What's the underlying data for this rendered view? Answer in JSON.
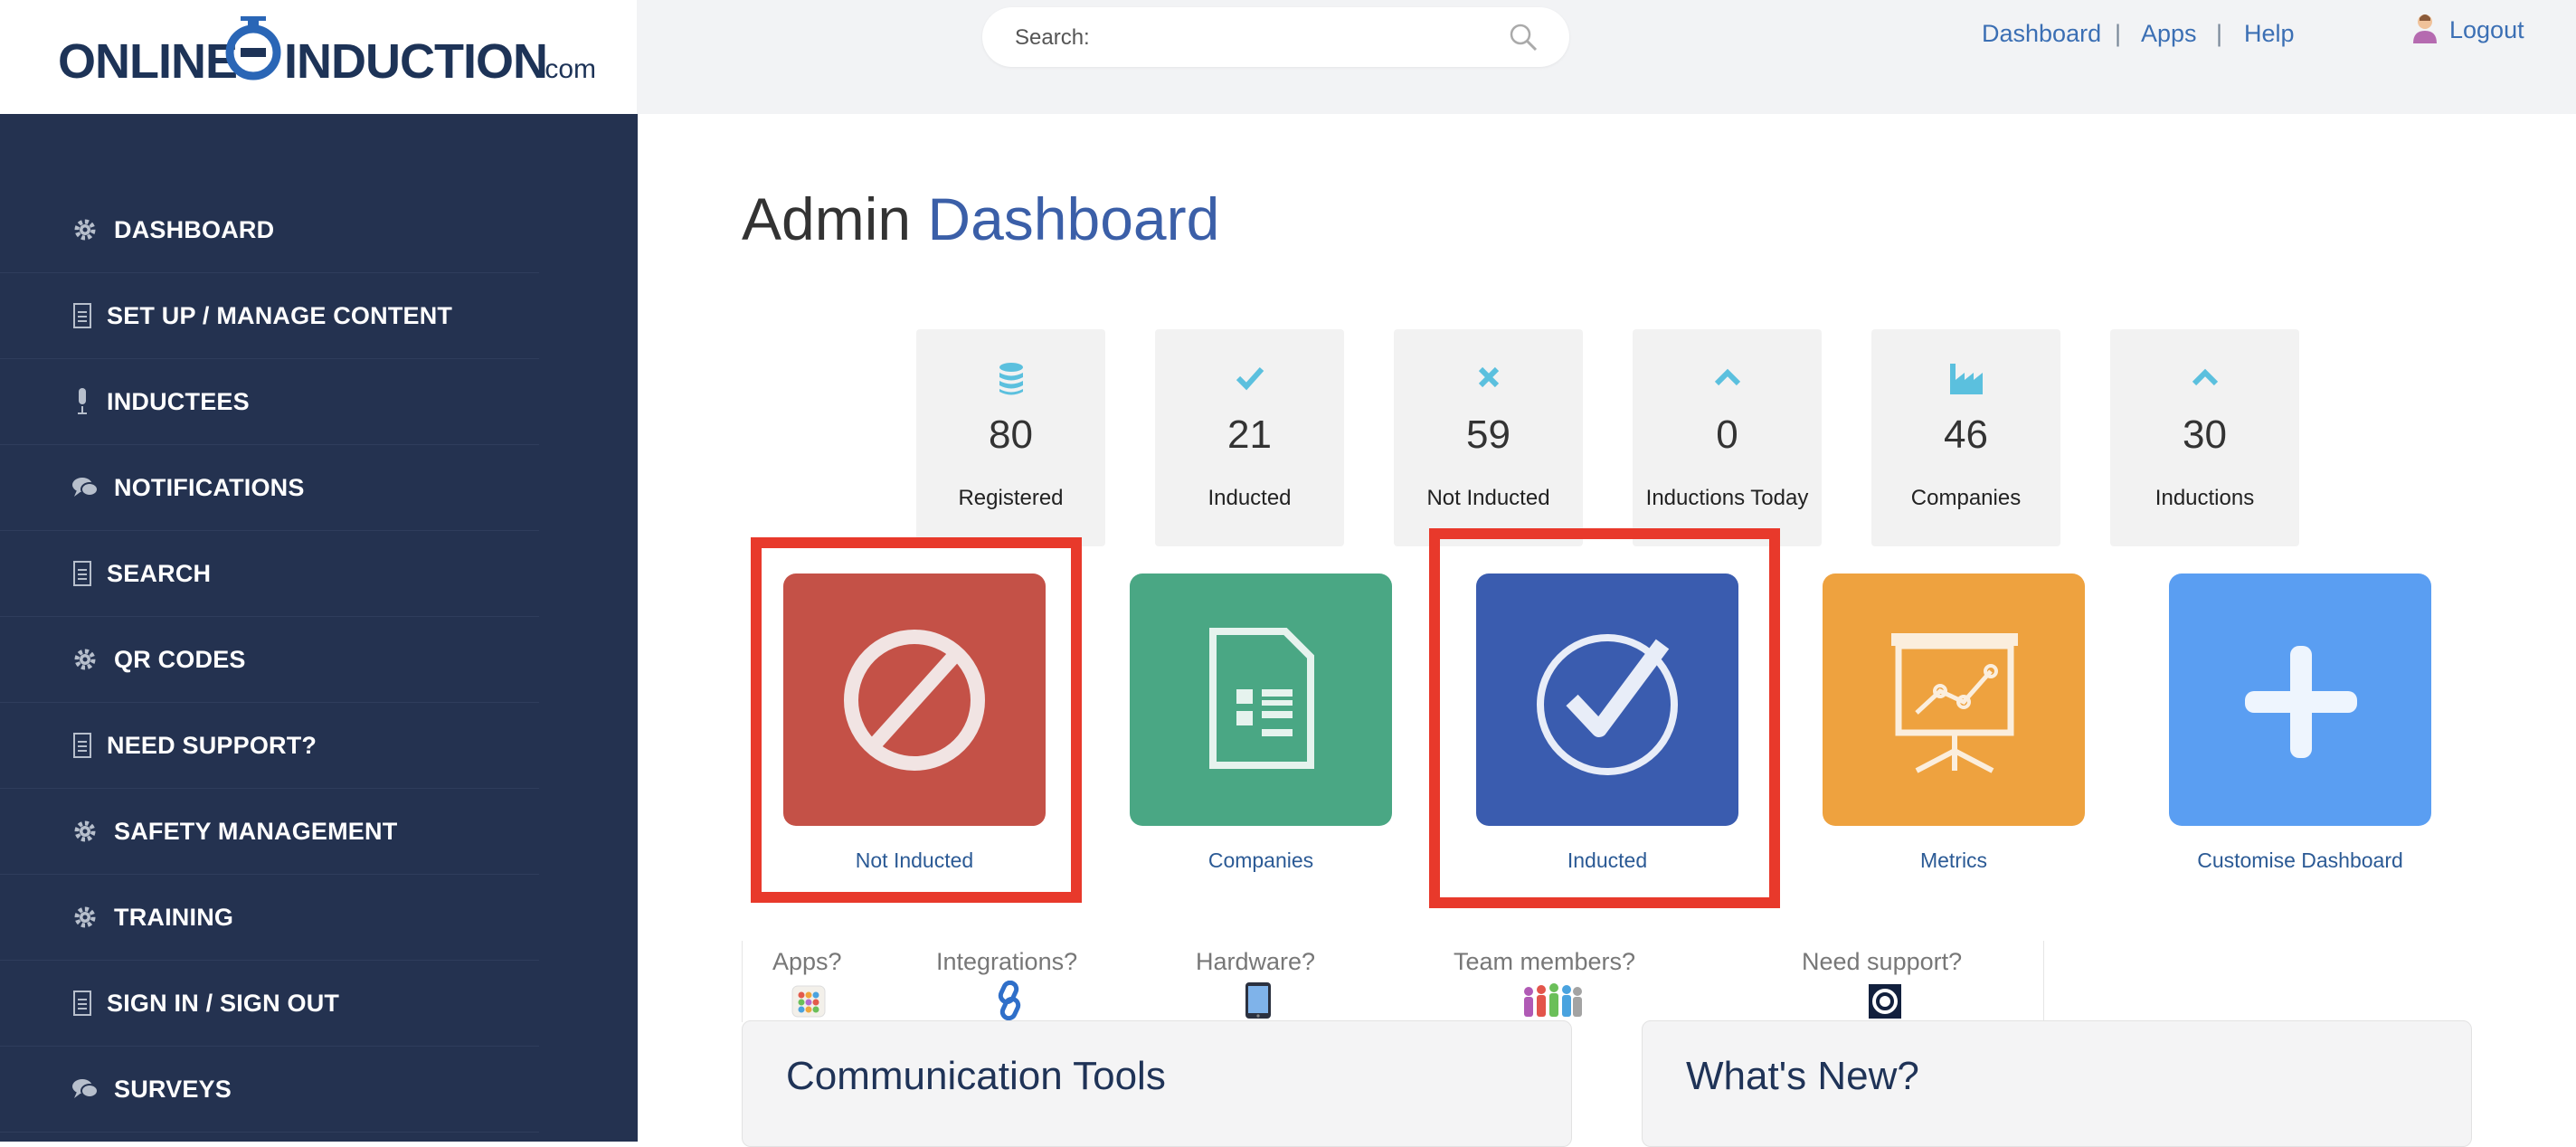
{
  "logo": {
    "text_left": "ONLINE",
    "text_right": "INDUCTION",
    "suffix": ".com"
  },
  "search": {
    "label": "Search:"
  },
  "top_nav": {
    "dashboard": "Dashboard",
    "apps": "Apps",
    "help": "Help",
    "separator": "|",
    "logout": "Logout"
  },
  "sidebar": {
    "items": [
      {
        "label": "DASHBOARD",
        "icon": "gear-icon"
      },
      {
        "label": "SET UP / MANAGE CONTENT",
        "icon": "document-icon"
      },
      {
        "label": "INDUCTEES",
        "icon": "microphone-icon"
      },
      {
        "label": "NOTIFICATIONS",
        "icon": "chat-icon"
      },
      {
        "label": "SEARCH",
        "icon": "document-icon"
      },
      {
        "label": "QR CODES",
        "icon": "gear-icon"
      },
      {
        "label": "NEED SUPPORT?",
        "icon": "document-icon"
      },
      {
        "label": "SAFETY MANAGEMENT",
        "icon": "gear-icon"
      },
      {
        "label": "TRAINING",
        "icon": "gear-icon"
      },
      {
        "label": "SIGN IN / SIGN OUT",
        "icon": "document-icon"
      },
      {
        "label": "SURVEYS",
        "icon": "chat-icon"
      }
    ]
  },
  "page": {
    "title_plain": "Admin",
    "title_accent": "Dashboard"
  },
  "stats": [
    {
      "value": "80",
      "label": "Registered",
      "icon": "database-icon"
    },
    {
      "value": "21",
      "label": "Inducted",
      "icon": "checkmark-icon"
    },
    {
      "value": "59",
      "label": "Not Inducted",
      "icon": "cross-icon"
    },
    {
      "value": "0",
      "label": "Inductions Today",
      "icon": "chevron-up-icon"
    },
    {
      "value": "46",
      "label": "Companies",
      "icon": "factory-icon"
    },
    {
      "value": "30",
      "label": "Inductions",
      "icon": "chevron-up-icon"
    }
  ],
  "tiles": [
    {
      "label": "Not Inducted",
      "color": "#c45147",
      "icon": "prohibited-icon"
    },
    {
      "label": "Companies",
      "color": "#4aa784",
      "icon": "document-list-icon"
    },
    {
      "label": "Inducted",
      "color": "#3a5caf",
      "icon": "check-circle-icon"
    },
    {
      "label": "Metrics",
      "color": "#eea23f",
      "icon": "presentation-chart-icon"
    },
    {
      "label": "Customise Dashboard",
      "color": "#5a9ef2",
      "icon": "plus-icon"
    }
  ],
  "help_links": [
    {
      "label": "Apps?",
      "icon": "apps-grid-icon"
    },
    {
      "label": "Integrations?",
      "icon": "link-icon"
    },
    {
      "label": "Hardware?",
      "icon": "tablet-icon"
    },
    {
      "label": "Team members?",
      "icon": "team-icon"
    },
    {
      "label": "Need support?",
      "icon": "support-icon"
    }
  ],
  "panels": {
    "communication": "Communication Tools",
    "whats_new": "What's New?"
  },
  "colors": {
    "sidebar_bg": "#243250",
    "accent_blue": "#3b5fa8",
    "stat_icon": "#5bc0de",
    "highlight_border": "#e8392b"
  }
}
